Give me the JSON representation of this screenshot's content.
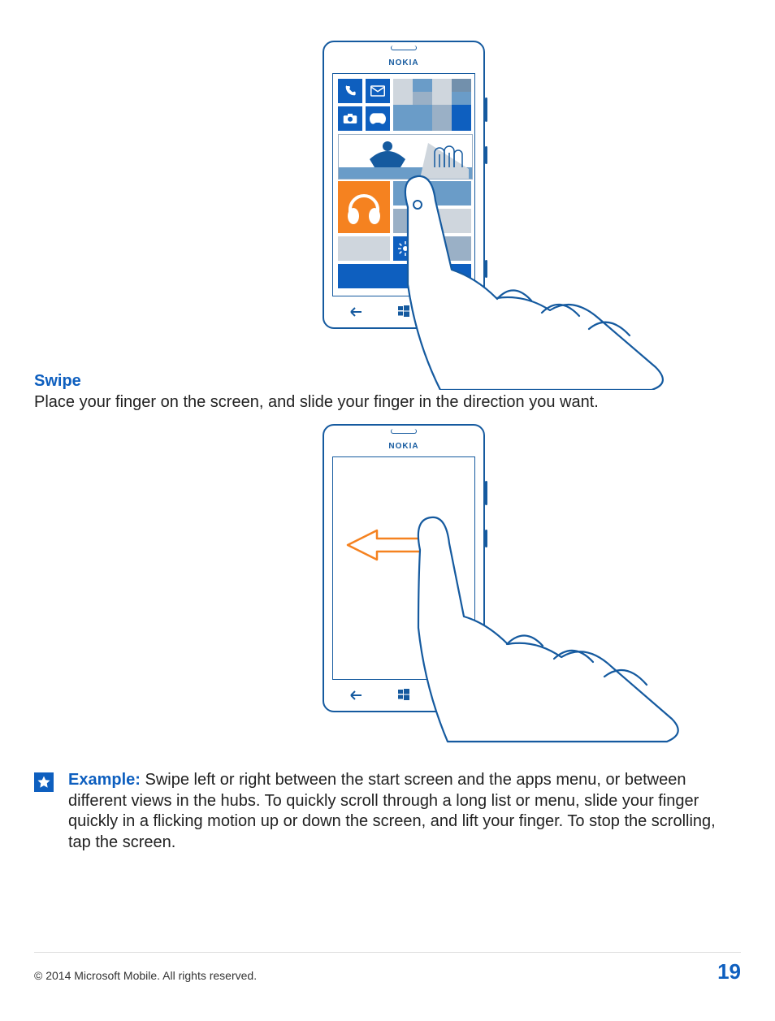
{
  "phone_brand": "NOKIA",
  "section1": {
    "heading": "Swipe",
    "body": "Place your finger on the screen, and slide your finger in the direction you want."
  },
  "callout": {
    "label": "Example:",
    "text": " Swipe left or right between the start screen and the apps menu, or between different views in the hubs. To quickly scroll through a long list or menu, slide your finger quickly in a flicking motion up or down the screen, and lift your finger. To stop the scrolling, tap the screen."
  },
  "footer": {
    "copyright": "© 2014 Microsoft Mobile. All rights reserved.",
    "page": "19"
  },
  "icons": {
    "phone": "phone-icon",
    "mail": "mail-icon",
    "camera": "camera-icon",
    "games": "games-icon",
    "music": "headphones-icon",
    "settings": "gear-icon",
    "back": "back-arrow-icon",
    "windows": "windows-icon",
    "search": "search-icon",
    "swipe_arrow": "swipe-left-arrow",
    "star": "star-icon"
  }
}
